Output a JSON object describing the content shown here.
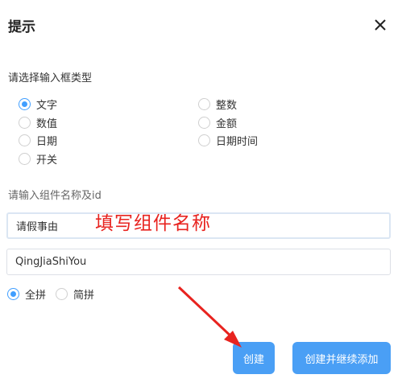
{
  "dialog": {
    "title": "提示",
    "close_icon": "close-icon"
  },
  "type_section": {
    "label": "请选择输入框类型",
    "options": [
      {
        "label": "文字",
        "selected": true
      },
      {
        "label": "整数",
        "selected": false
      },
      {
        "label": "数值",
        "selected": false
      },
      {
        "label": "金额",
        "selected": false
      },
      {
        "label": "日期",
        "selected": false
      },
      {
        "label": "日期时间",
        "selected": false
      },
      {
        "label": "开关",
        "selected": false
      }
    ]
  },
  "name_section": {
    "label": "请输入组件名称及id",
    "name_value": "请假事由",
    "id_value": "QingJiaShiYou",
    "pinyin_options": [
      {
        "label": "全拼",
        "selected": true
      },
      {
        "label": "简拼",
        "selected": false
      }
    ]
  },
  "annotation": {
    "text": "填写组件名称",
    "color": "#e8231f"
  },
  "buttons": {
    "create": "创建",
    "create_continue": "创建并继续添加"
  },
  "colors": {
    "accent": "#409eff",
    "button": "#4a9ff5"
  }
}
